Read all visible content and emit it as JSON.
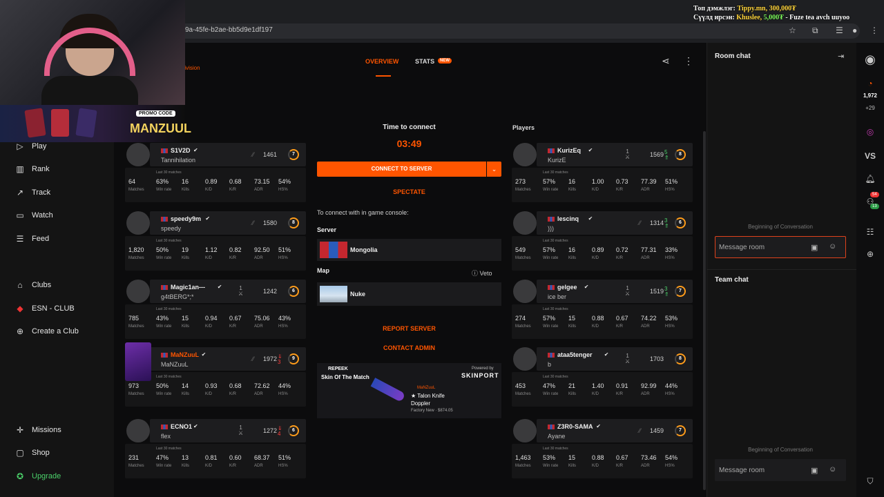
{
  "browser": {
    "url_fragment": "9a-45fe-b2ae-bb5d9e1df197"
  },
  "overlay": {
    "promo_code_label": "PROMO CODE",
    "promo_name": "MANZUUL",
    "donation_line1_prefix": "Топ дэмжлэг: ",
    "donation_line1_value": "Tippy.mn, 300,000₮",
    "donation_line2_prefix": "Сүүлд ирсэн: ",
    "donation_line2_name": "Khuslee, ",
    "donation_line2_amount": "5,000₮",
    "donation_line2_msg": " - Fuze tea avch uuyoo"
  },
  "sidebar": {
    "items": [
      {
        "label": "Play",
        "icon": "play-icon"
      },
      {
        "label": "Rank",
        "icon": "rank-icon"
      },
      {
        "label": "Track",
        "icon": "track-icon"
      },
      {
        "label": "Watch",
        "icon": "watch-icon"
      },
      {
        "label": "Feed",
        "icon": "feed-icon"
      },
      {
        "label": "Clubs",
        "icon": "clubs-icon"
      },
      {
        "label": "ESN - CLUB",
        "icon": "esn-club-icon"
      },
      {
        "label": "Create a Club",
        "icon": "create-club-icon"
      },
      {
        "label": "Missions",
        "icon": "missions-icon"
      },
      {
        "label": "Shop",
        "icon": "shop-icon"
      },
      {
        "label": "Upgrade",
        "icon": "upgrade-icon"
      }
    ]
  },
  "header": {
    "division_text": "r division",
    "tabs": [
      {
        "label": "OVERVIEW"
      },
      {
        "label": "STATS"
      }
    ],
    "stats_badge": "NEW"
  },
  "players_header": "Players",
  "stat_labels": {
    "last30": "Last 30 matches",
    "matches": "Matches",
    "winrate": "Win rate",
    "kills": "Kills",
    "kd": "K/D",
    "kr": "K/R",
    "adr": "ADR",
    "hs": "HS%"
  },
  "team1": [
    {
      "name": "S1V2D",
      "sub": "Tannihilation",
      "elo": "1461",
      "level": "7",
      "matches": "64",
      "winrate": "63%",
      "kills": "16",
      "kd": "0.89",
      "kr": "0.68",
      "adr": "73.15",
      "hs": "54%"
    },
    {
      "name": "speedy9m",
      "sub": "speedy",
      "elo": "1580",
      "level": "8",
      "matches": "1,820",
      "winrate": "50%",
      "kills": "19",
      "kd": "1.12",
      "kr": "0.82",
      "adr": "92.50",
      "hs": "51%"
    },
    {
      "name": "Magic1an---",
      "sub": "g4tBERG*;*",
      "elo": "1242",
      "level": "6",
      "party": "1",
      "matches": "785",
      "winrate": "43%",
      "kills": "15",
      "kd": "0.94",
      "kr": "0.67",
      "adr": "75.06",
      "hs": "43%"
    },
    {
      "name": "MaNZuuL",
      "sub": "MaNZuuL",
      "elo": "1972",
      "level": "9",
      "delta": "3",
      "matches": "973",
      "winrate": "50%",
      "kills": "14",
      "kd": "0.93",
      "kr": "0.68",
      "adr": "72.62",
      "hs": "44%"
    },
    {
      "name": "ECNO1",
      "sub": "flex",
      "elo": "1272",
      "level": "6",
      "party": "1",
      "delta": "4",
      "matches": "231",
      "winrate": "47%",
      "kills": "13",
      "kd": "0.81",
      "kr": "0.60",
      "adr": "68.37",
      "hs": "51%"
    }
  ],
  "team2": [
    {
      "name": "KurizEq",
      "sub": "KurizE",
      "elo": "1569",
      "level": "8",
      "party": "1",
      "delta": "5",
      "matches": "273",
      "winrate": "57%",
      "kills": "16",
      "kd": "1.00",
      "kr": "0.73",
      "adr": "77.39",
      "hs": "51%"
    },
    {
      "name": "lescinq",
      "sub": ")))",
      "elo": "1314",
      "level": "6",
      "delta": "3",
      "matches": "549",
      "winrate": "57%",
      "kills": "16",
      "kd": "0.89",
      "kr": "0.72",
      "adr": "77.31",
      "hs": "33%"
    },
    {
      "name": "gelgee",
      "sub": "ice ber",
      "elo": "1519",
      "level": "7",
      "party": "1",
      "delta": "3",
      "matches": "274",
      "winrate": "57%",
      "kills": "15",
      "kd": "0.88",
      "kr": "0.67",
      "adr": "74.22",
      "hs": "53%"
    },
    {
      "name": "ataa5tenger",
      "sub": "b",
      "elo": "1703",
      "level": "8",
      "party": "1",
      "matches": "453",
      "winrate": "47%",
      "kills": "21",
      "kd": "1.40",
      "kr": "0.91",
      "adr": "92.99",
      "hs": "44%"
    },
    {
      "name": "Z3R0-SAMA",
      "sub": "Ayane",
      "elo": "1459",
      "level": "7",
      "matches": "1,463",
      "winrate": "53%",
      "kills": "15",
      "kd": "0.88",
      "kr": "0.67",
      "adr": "73.46",
      "hs": "54%"
    }
  ],
  "center": {
    "time_to_connect": "Time to connect",
    "timer": "03:49",
    "connect_btn": "CONNECT TO SERVER",
    "spectate": "SPECTATE",
    "console_note": "To connect with in game console:",
    "server_label": "Server",
    "server_name": "Mongolia",
    "map_label": "Map",
    "veto": "Veto",
    "map_name": "Nuke",
    "report": "REPORT SERVER",
    "contact": "CONTACT ADMIN",
    "sotm_brand": "REPEEK",
    "sotm_title": "Skin Of The Match",
    "sotm_powered": "Powered by",
    "sotm_sponsor": "SKINPORT",
    "sotm_owner": "MaNZuuL",
    "sotm_item1": "★ Talon Knife",
    "sotm_item2": "Doppler",
    "sotm_price": "Factory New · $874.05"
  },
  "chat": {
    "room_title": "Room chat",
    "team_title": "Team chat",
    "beginning": "Beginning of Conversation",
    "placeholder": "Message room"
  },
  "rail": {
    "stat1": "1,972",
    "stat2": "+29",
    "vs": "VS",
    "badge1": "54",
    "badge2": "13"
  },
  "colors": {
    "accent": "#ff5500",
    "green": "#4bd06a",
    "red": "#ff3b3b"
  }
}
